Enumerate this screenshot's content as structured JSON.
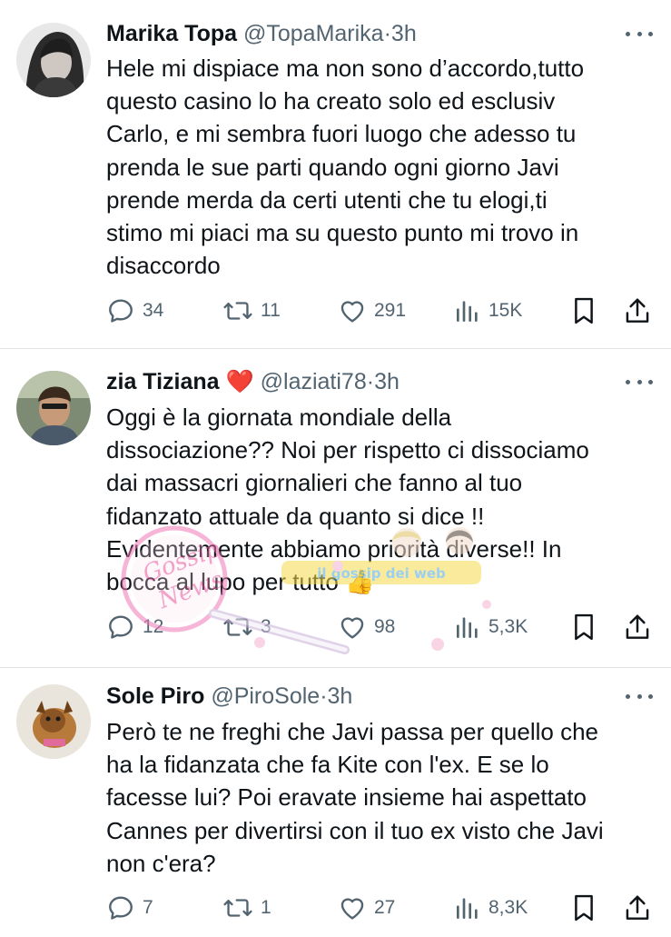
{
  "tweets": [
    {
      "name": "Marika Topa",
      "name_suffix": "",
      "handle": "@TopaMarika",
      "separator": "·",
      "time": "3h",
      "lines": [
        "Hele mi dispiace ma non sono d’accordo,tutto",
        "questo casino lo ha creato solo ed esclusiv",
        "Carlo, e mi sembra fuori luogo che adesso tu",
        "prenda le sue parti quando ogni giorno Javi",
        "prende merda da certi utenti che tu elogi,ti",
        "stimo mi piaci ma su questo punto mi trovo in",
        "disaccordo"
      ],
      "replies": "34",
      "reposts": "11",
      "likes": "291",
      "views": "15K"
    },
    {
      "name": "zia Tiziana",
      "name_suffix": "❤️",
      "handle": "@laziati78",
      "separator": "·",
      "time": "3h",
      "lines": [
        "Oggi è la giornata mondiale della",
        "dissociazione?? Noi per rispetto ci dissociamo",
        "dai massacri giornalieri che fanno al tuo",
        "fidanzato attuale da quanto si dice !!",
        "Evidentemente abbiamo priorità diverse!! In",
        "bocca al lupo per tutto 👍"
      ],
      "replies": "12",
      "reposts": "3",
      "likes": "98",
      "views": "5,3K"
    },
    {
      "name": "Sole Piro",
      "name_suffix": "",
      "handle": "@PiroSole",
      "separator": "·",
      "time": "3h",
      "lines": [
        "Però te ne freghi che Javi passa per quello che",
        "ha la fidanzata che fa Kite con l'ex. E se lo",
        "facesse lui? Poi eravate insieme hai aspettato",
        "Cannes per divertirsi con il tuo ex visto che Javi",
        "non c'era?"
      ],
      "replies": "7",
      "reposts": "1",
      "likes": "27",
      "views": "8,3K"
    }
  ],
  "icons": {
    "reply": "reply-icon",
    "repost": "repost-icon",
    "like": "heart-icon",
    "views": "views-icon",
    "bookmark": "bookmark-icon",
    "share": "share-icon",
    "more": "more-icon"
  },
  "watermark": {
    "seal_text": "Gossip News",
    "banner_text": "il gossip dei web"
  },
  "colors": {
    "text": "#0f1419",
    "secondary": "#536471",
    "divider": "#dfe3e6",
    "heart": "#e0245e"
  }
}
